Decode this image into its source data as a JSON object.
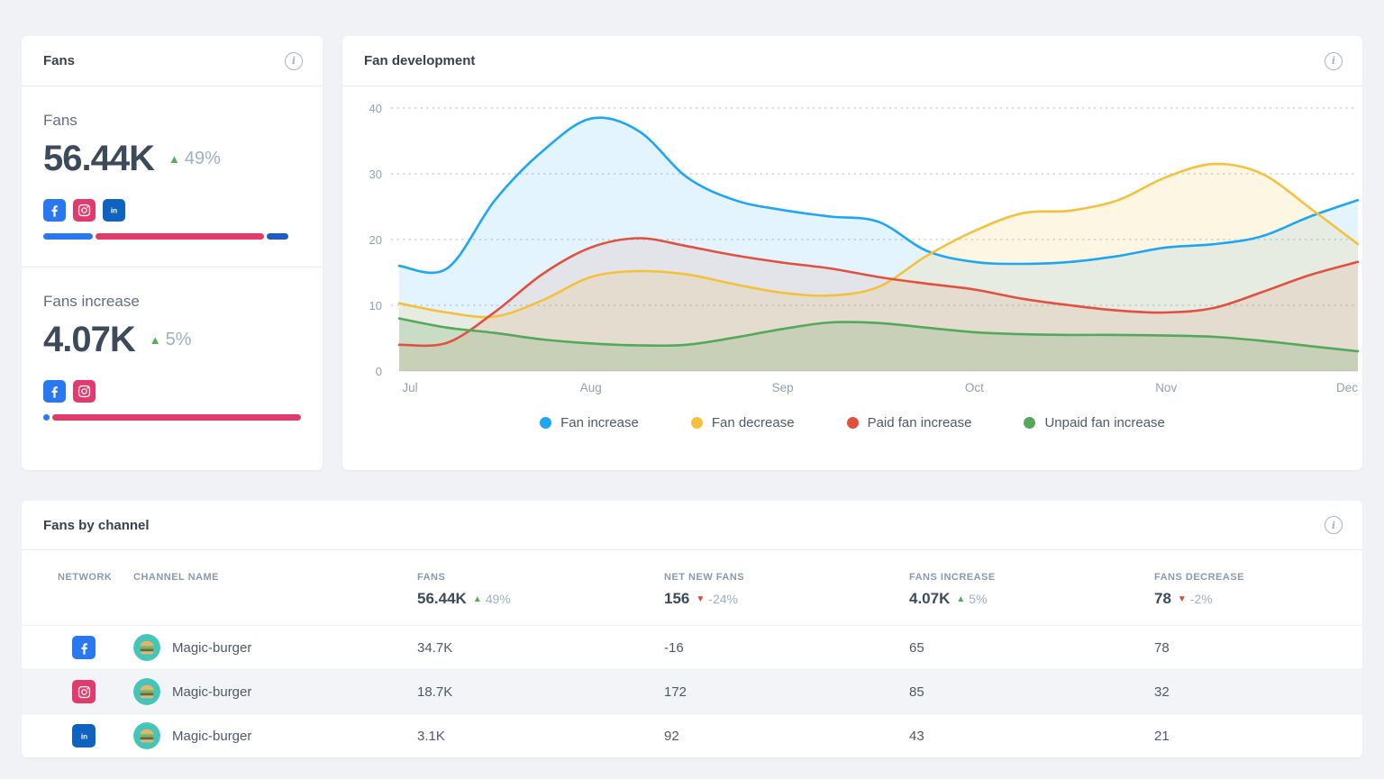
{
  "fans_card": {
    "title": "Fans",
    "sections": [
      {
        "label": "Fans",
        "value": "56.44K",
        "delta": "49%",
        "delta_dir": "up",
        "networks": [
          "facebook",
          "instagram",
          "linkedin"
        ],
        "bar": {
          "width_pct": 95,
          "segments": [
            {
              "network": "facebook",
              "color": "#2a77f2",
              "fraction": 20.7
            },
            {
              "network": "instagram",
              "color": "#e23a6d",
              "fraction": 70.5
            },
            {
              "network": "linkedin",
              "color": "#1d5cc0",
              "fraction": 8.8
            }
          ]
        }
      },
      {
        "label": "Fans increase",
        "value": "4.07K",
        "delta": "5%",
        "delta_dir": "up",
        "networks": [
          "facebook",
          "instagram"
        ],
        "bar": {
          "width_pct": 100,
          "segments": [
            {
              "network": "facebook",
              "color": "#2a77f2",
              "fraction": 2.3
            },
            {
              "network": "instagram",
              "color": "#e23a6d",
              "fraction": 97.7
            }
          ]
        }
      }
    ]
  },
  "chart_card": {
    "title": "Fan development"
  },
  "chart_data": {
    "type": "area",
    "title": "Fan development",
    "x_labels": [
      "Jul",
      "Aug",
      "Sep",
      "Oct",
      "Nov",
      "Dec"
    ],
    "y_ticks": [
      0,
      10,
      20,
      30,
      40
    ],
    "ylim": [
      0,
      42
    ],
    "grid": "dotted-horizontal",
    "legend_position": "bottom",
    "series": [
      {
        "name": "Fan increase",
        "color": "#1ea6f3",
        "fill_opacity": 0.12,
        "points": [
          [
            0,
            16
          ],
          [
            0.25,
            15.6
          ],
          [
            0.5,
            26
          ],
          [
            0.75,
            33.5
          ],
          [
            1,
            38.4
          ],
          [
            1.25,
            36.5
          ],
          [
            1.5,
            29.5
          ],
          [
            1.75,
            26
          ],
          [
            2,
            24.5
          ],
          [
            2.25,
            23.5
          ],
          [
            2.5,
            22.7
          ],
          [
            2.75,
            18.3
          ],
          [
            3,
            16.6
          ],
          [
            3.25,
            16.3
          ],
          [
            3.5,
            16.6
          ],
          [
            3.75,
            17.5
          ],
          [
            4,
            18.8
          ],
          [
            4.25,
            19.3
          ],
          [
            4.5,
            20.5
          ],
          [
            4.75,
            23.5
          ],
          [
            5,
            26
          ]
        ]
      },
      {
        "name": "Fan decrease",
        "color": "#f4c13d",
        "fill_opacity": 0.15,
        "points": [
          [
            0,
            10.3
          ],
          [
            0.25,
            8.9
          ],
          [
            0.5,
            8.3
          ],
          [
            0.75,
            10.8
          ],
          [
            1,
            14.3
          ],
          [
            1.25,
            15.2
          ],
          [
            1.5,
            14.7
          ],
          [
            1.75,
            13.2
          ],
          [
            2,
            11.9
          ],
          [
            2.25,
            11.5
          ],
          [
            2.5,
            12.8
          ],
          [
            2.75,
            17.5
          ],
          [
            3,
            21.3
          ],
          [
            3.25,
            24
          ],
          [
            3.5,
            24.4
          ],
          [
            3.75,
            26
          ],
          [
            4,
            29.5
          ],
          [
            4.25,
            31.5
          ],
          [
            4.5,
            30
          ],
          [
            4.75,
            24.8
          ],
          [
            5,
            19.3
          ]
        ]
      },
      {
        "name": "Paid fan increase",
        "color": "#e2503f",
        "fill_opacity": 0.1,
        "points": [
          [
            0,
            4
          ],
          [
            0.25,
            4.3
          ],
          [
            0.5,
            9
          ],
          [
            0.75,
            14.8
          ],
          [
            1,
            18.8
          ],
          [
            1.25,
            20.2
          ],
          [
            1.5,
            19
          ],
          [
            1.75,
            17.6
          ],
          [
            2,
            16.5
          ],
          [
            2.25,
            15.6
          ],
          [
            2.5,
            14.3
          ],
          [
            2.75,
            13.3
          ],
          [
            3,
            12.4
          ],
          [
            3.25,
            11
          ],
          [
            3.5,
            10
          ],
          [
            3.75,
            9.2
          ],
          [
            4,
            8.9
          ],
          [
            4.25,
            9.6
          ],
          [
            4.5,
            12
          ],
          [
            4.75,
            14.6
          ],
          [
            5,
            16.6
          ]
        ]
      },
      {
        "name": "Unpaid fan increase",
        "color": "#55a75a",
        "fill_opacity": 0.2,
        "points": [
          [
            0,
            8
          ],
          [
            0.25,
            6.6
          ],
          [
            0.5,
            5.8
          ],
          [
            0.75,
            4.8
          ],
          [
            1,
            4.2
          ],
          [
            1.25,
            3.9
          ],
          [
            1.5,
            4
          ],
          [
            1.75,
            5.1
          ],
          [
            2,
            6.4
          ],
          [
            2.25,
            7.4
          ],
          [
            2.5,
            7.3
          ],
          [
            2.75,
            6.6
          ],
          [
            3,
            5.9
          ],
          [
            3.25,
            5.6
          ],
          [
            3.5,
            5.5
          ],
          [
            3.75,
            5.5
          ],
          [
            4,
            5.4
          ],
          [
            4.25,
            5.2
          ],
          [
            4.5,
            4.6
          ],
          [
            4.75,
            3.8
          ],
          [
            5,
            3
          ]
        ]
      }
    ]
  },
  "table_card": {
    "title": "Fans by channel",
    "columns": [
      {
        "key": "network",
        "label": "NETWORK"
      },
      {
        "key": "channel",
        "label": "CHANNEL NAME"
      },
      {
        "key": "fans",
        "label": "FANS",
        "summary": "56.44K",
        "delta": "49%",
        "delta_dir": "up"
      },
      {
        "key": "net_new",
        "label": "NET NEW FANS",
        "summary": "156",
        "delta": "-24%",
        "delta_dir": "down"
      },
      {
        "key": "increase",
        "label": "FANS INCREASE",
        "summary": "4.07K",
        "delta": "5%",
        "delta_dir": "up"
      },
      {
        "key": "decrease",
        "label": "FANS DECREASE",
        "summary": "78",
        "delta": "-2%",
        "delta_dir": "down"
      }
    ],
    "rows": [
      {
        "network": "facebook",
        "channel": "Magic-burger",
        "fans": "34.7K",
        "net_new": "-16",
        "increase": "65",
        "decrease": "78"
      },
      {
        "network": "instagram",
        "channel": "Magic-burger",
        "fans": "18.7K",
        "net_new": "172",
        "increase": "85",
        "decrease": "32"
      },
      {
        "network": "linkedin",
        "channel": "Magic-burger",
        "fans": "3.1K",
        "net_new": "92",
        "increase": "43",
        "decrease": "21"
      }
    ]
  },
  "colors": {
    "page_bg": "#f0f2f5",
    "facebook": "#2a77f2",
    "instagram": "#e23a6d",
    "linkedin": "#0f63be",
    "delta_up": "#50ae55",
    "delta_down": "#e2432e",
    "axis_text": "#8fa0b3",
    "gridline": "#d3d8de"
  },
  "glyphs": {
    "up": "▲",
    "down": "▼",
    "info": "i"
  }
}
